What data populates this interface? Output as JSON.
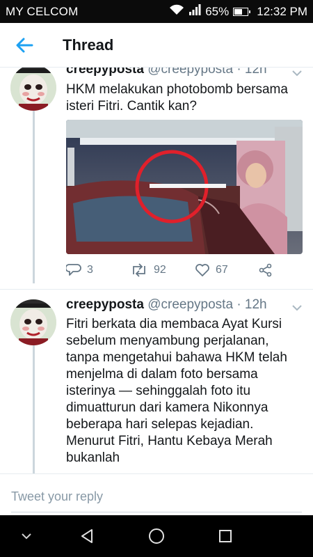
{
  "status_bar": {
    "carrier": "MY CELCOM",
    "battery_percent": "65%",
    "battery_level": 0.65,
    "time": "12:32 PM",
    "icons": [
      "wifi-icon",
      "signal-icon",
      "battery-icon"
    ]
  },
  "header": {
    "back_icon": "back-arrow-icon",
    "title": "Thread"
  },
  "tweets": [
    {
      "name": "creepyposta",
      "handle": "@creepyposta",
      "time": "12h",
      "text": "HKM melakukan photobomb bersama isteri Fitri. Cantik kan?",
      "stats": {
        "replies": "3",
        "retweets": "92",
        "likes": "67"
      }
    },
    {
      "name": "creepyposta",
      "handle": "@creepyposta",
      "time": "12h",
      "text": "Fitri berkata dia membaca Ayat Kursi sebelum menyambung perjalanan, tanpa mengetahui bahawa HKM telah menjelma di dalam foto bersama isterinya — sehinggalah foto itu dimuatturun dari kamera Nikonnya beberapa hari selepas kejadian. Menurut Fitri, Hantu Kebaya Merah bukanlah"
    }
  ],
  "reply_bar": {
    "placeholder": "Tweet your reply"
  },
  "nav_bar": {
    "icons": [
      "chevron-down-icon",
      "back-triangle-icon",
      "home-circle-icon",
      "recents-square-icon"
    ]
  },
  "colors": {
    "accent": "#1da1f2",
    "muted": "#657786",
    "annotation_red": "#e0202b"
  }
}
